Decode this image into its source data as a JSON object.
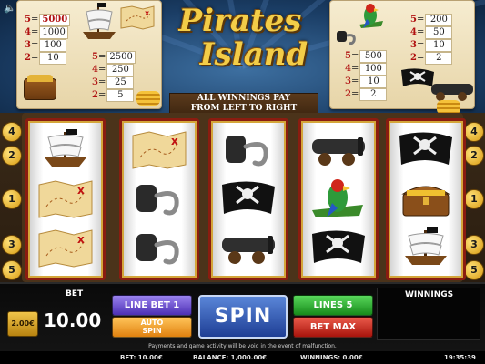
{
  "title": {
    "line1": "Pirates",
    "line2": "Island"
  },
  "rule": {
    "line1": "ALL WINNINGS PAY",
    "line2": "FROM LEFT TO RIGHT"
  },
  "paytable_left": {
    "col1": [
      {
        "count": "5",
        "value": "5000"
      },
      {
        "count": "4",
        "value": "1000"
      },
      {
        "count": "3",
        "value": "100"
      },
      {
        "count": "2",
        "value": "10"
      }
    ],
    "col2": [
      {
        "count": "5",
        "value": "2500"
      },
      {
        "count": "4",
        "value": "250"
      },
      {
        "count": "3",
        "value": "25"
      },
      {
        "count": "2",
        "value": "5"
      }
    ]
  },
  "paytable_right": {
    "col1": [
      {
        "count": "5",
        "value": "200"
      },
      {
        "count": "4",
        "value": "50"
      },
      {
        "count": "3",
        "value": "10"
      },
      {
        "count": "2",
        "value": "2"
      }
    ],
    "col2": [
      {
        "count": "5",
        "value": "500"
      },
      {
        "count": "4",
        "value": "100"
      },
      {
        "count": "3",
        "value": "10"
      },
      {
        "count": "2",
        "value": "2"
      }
    ]
  },
  "paylines_left": [
    "4",
    "2",
    "1",
    "3",
    "5"
  ],
  "paylines_right": [
    "4",
    "2",
    "1",
    "3",
    "5"
  ],
  "reels": [
    [
      "ship",
      "map",
      "map"
    ],
    [
      "map",
      "hook",
      "hook"
    ],
    [
      "hook",
      "pirate-flag",
      "cannon"
    ],
    [
      "cannon",
      "parrot",
      "pirate-flag"
    ],
    [
      "pirate-flag",
      "treasure-chest",
      "ship"
    ]
  ],
  "controls": {
    "coin_value": "2.00€",
    "bet_label": "BET",
    "bet_value": "10.00",
    "line_bet": "LINE BET 1",
    "auto_spin_line1": "AUTO",
    "auto_spin_line2": "SPIN",
    "spin": "SPIN",
    "lines": "LINES 5",
    "bet_max": "BET MAX",
    "winnings_label": "WINNINGS",
    "notice": "Payments and game activity will be void in the event of malfunction."
  },
  "status": {
    "bet": "BET: 10.00€",
    "balance": "BALANCE: 1,000.00€",
    "winnings": "WINNINGS: 0.00€",
    "clock": "19:35:39"
  },
  "colors": {
    "reel_frame": "#8a1c10",
    "gold": "#f3cd48",
    "spin": "#1e3e95"
  }
}
